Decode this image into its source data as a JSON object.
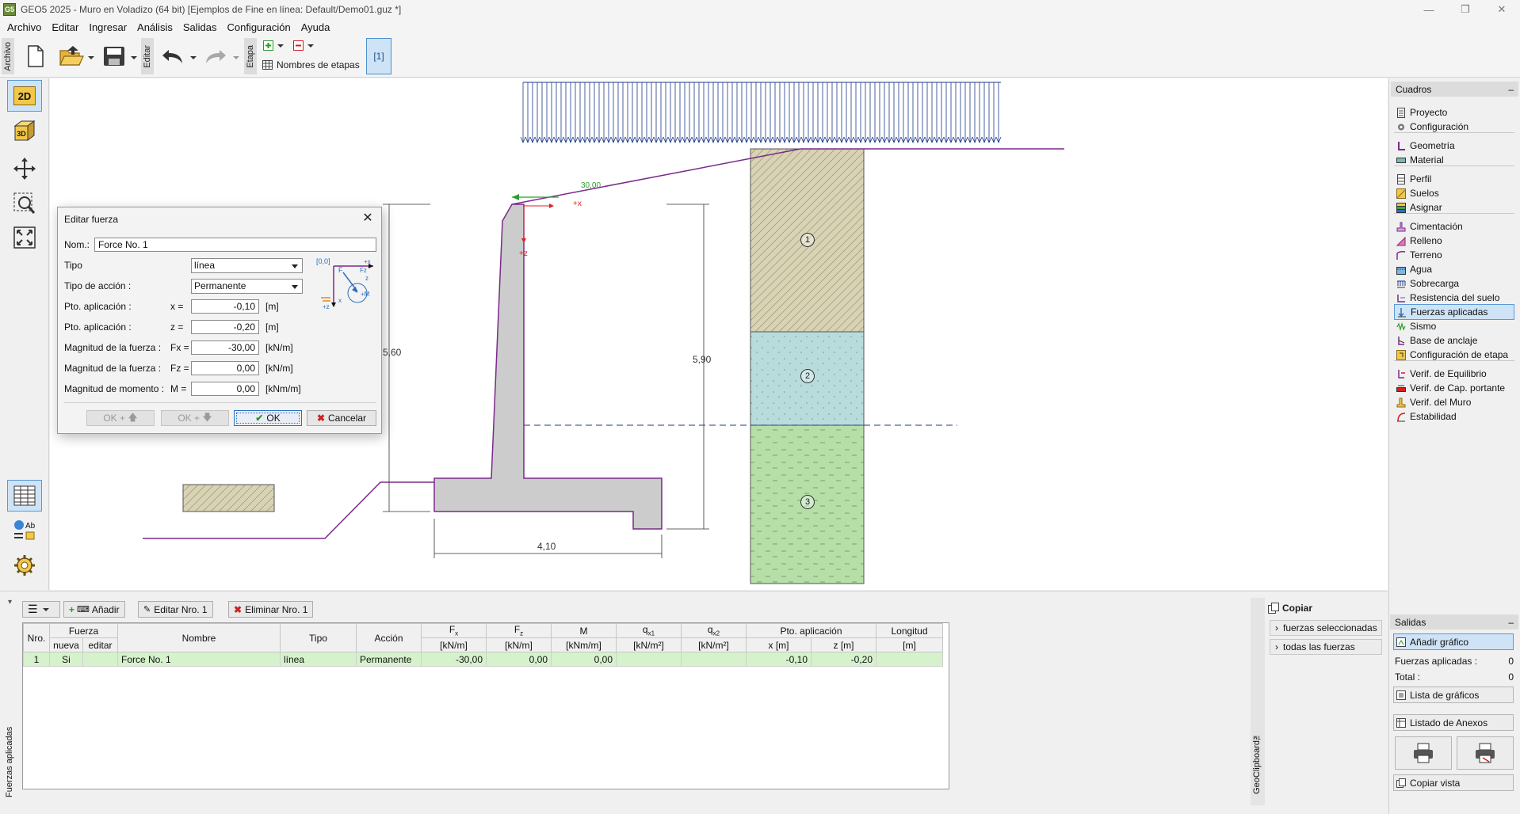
{
  "window": {
    "title": "GEO5 2025 - Muro en Voladizo (64 bit) [Ejemplos de Fine en línea: Default/Demo01.guz *]",
    "app_icon_text": "G5"
  },
  "menu": [
    "Archivo",
    "Editar",
    "Ingresar",
    "Análisis",
    "Salidas",
    "Configuración",
    "Ayuda"
  ],
  "toolbar": {
    "archivo_tab": "Archivo",
    "editar_tab": "Editar",
    "etapa_tab": "Etapa",
    "stage_names_label": "Nombres de etapas",
    "stage_button": "[1]"
  },
  "leftrail": {
    "btn_2d": "2D",
    "btn_3d": "3D"
  },
  "canvas": {
    "dim_height_wall": "5,60",
    "dim_height_soil": "5,90",
    "dim_base_width": "4,10",
    "force_value": "30,00",
    "axis_x": "+x",
    "axis_z": "+z",
    "soil_layers": [
      "1",
      "2",
      "3"
    ],
    "colors": {
      "wall": "#cccccc",
      "outline": "#7a2a8a",
      "soil1": "#d8d3b4",
      "soil2": "#b8dcdc",
      "soil3": "#b6dfa8",
      "surcharge": "#1f3b88",
      "force": "#2aa02a"
    }
  },
  "dialog": {
    "title": "Editar fuerza",
    "name_label": "Nom.:",
    "name_value": "Force No. 1",
    "type_label": "Tipo",
    "type_value": "línea",
    "action_label": "Tipo de acción :",
    "action_value": "Permanente",
    "rows": [
      {
        "label": "Pto. aplicación :",
        "eq": "x  =",
        "value": "-0,10",
        "unit": "[m]"
      },
      {
        "label": "Pto. aplicación :",
        "eq": "z  =",
        "value": "-0,20",
        "unit": "[m]"
      },
      {
        "label": "Magnitud de la fuerza :",
        "eq": "Fx =",
        "value": "-30,00",
        "unit": "[kN/m]"
      },
      {
        "label": "Magnitud de la fuerza :",
        "eq": "Fz =",
        "value": "0,00",
        "unit": "[kN/m]"
      },
      {
        "label": "Magnitud de momento :",
        "eq": "M =",
        "value": "0,00",
        "unit": "[kNm/m]"
      }
    ],
    "diagram": {
      "origin": "[0,0]",
      "fx": "+x",
      "f": "F",
      "fz": "Fz",
      "z": "z",
      "m": "+M",
      "x_axis": "x",
      "z_axis": "+z"
    },
    "btn_ok_up": "OK +",
    "btn_ok_down": "OK +",
    "btn_ok": "OK",
    "btn_cancel": "Cancelar"
  },
  "right_panel": {
    "header": "Cuadros",
    "collapse": "–",
    "items": [
      {
        "label": "Proyecto",
        "icon": "document-icon"
      },
      {
        "label": "Configuración",
        "icon": "gear-icon"
      },
      {
        "label": "Geometría",
        "icon": "geometry-icon"
      },
      {
        "label": "Material",
        "icon": "material-icon"
      },
      {
        "label": "Perfil",
        "icon": "profile-icon"
      },
      {
        "label": "Suelos",
        "icon": "soils-icon"
      },
      {
        "label": "Asignar",
        "icon": "assign-icon"
      },
      {
        "label": "Cimentación",
        "icon": "foundation-icon"
      },
      {
        "label": "Relleno",
        "icon": "backfill-icon"
      },
      {
        "label": "Terreno",
        "icon": "terrain-icon"
      },
      {
        "label": "Agua",
        "icon": "water-icon"
      },
      {
        "label": "Sobrecarga",
        "icon": "surcharge-icon"
      },
      {
        "label": "Resistencia del suelo",
        "icon": "resistance-icon"
      },
      {
        "label": "Fuerzas aplicadas",
        "icon": "forces-icon",
        "active": true
      },
      {
        "label": "Sismo",
        "icon": "earthquake-icon"
      },
      {
        "label": "Base de anclaje",
        "icon": "anchor-icon"
      },
      {
        "label": "Configuración de etapa",
        "icon": "stage-config-icon"
      },
      {
        "label": "Verif. de Equilibrio",
        "icon": "equilibrium-icon"
      },
      {
        "label": "Verif. de Cap. portante",
        "icon": "bearing-icon"
      },
      {
        "label": "Verif. del Muro",
        "icon": "wall-check-icon"
      },
      {
        "label": "Estabilidad",
        "icon": "stability-icon"
      }
    ]
  },
  "bottom": {
    "side_label": "Fuerzas aplicadas",
    "btn_add": "Añadir",
    "btn_edit": "Editar Nro. 1",
    "btn_delete": "Eliminar Nro. 1",
    "table": {
      "headers_top": [
        "Nro.",
        "Fuerza",
        "Nombre",
        "Tipo",
        "Acción",
        "F",
        "F",
        "M",
        "q",
        "q",
        "Pto. aplicación",
        "Longitud"
      ],
      "header_subs": {
        "fx": "x",
        "fz": "z",
        "qx1": "x1",
        "qx2": "x2"
      },
      "headers_bottom": [
        "nueva",
        "editar",
        "[kN/m]",
        "[kN/m]",
        "[kNm/m]",
        "[kN/m²]",
        "[kN/m²]",
        "x [m]",
        "z [m]",
        "[m]"
      ],
      "rows": [
        {
          "nro": "1",
          "nueva": "Si",
          "editar": "",
          "nombre": "Force No. 1",
          "tipo": "línea",
          "accion": "Permanente",
          "fx": "-30,00",
          "fz": "0,00",
          "m": "0,00",
          "qx1": "",
          "qx2": "",
          "x": "-0,10",
          "z": "-0,20",
          "longitud": ""
        }
      ]
    },
    "geoclipboard_label": "GeoClipboard™",
    "copy_title": "Copiar",
    "copy_selected": "fuerzas seleccionadas",
    "copy_all": "todas las fuerzas"
  },
  "outputs": {
    "header": "Salidas",
    "collapse": "–",
    "add_graphic": "Añadir gráfico",
    "forces_label": "Fuerzas aplicadas :",
    "forces_count": "0",
    "total_label": "Total :",
    "total_count": "0",
    "graphics_list": "Lista de gráficos",
    "annex_list": "Listado de Anexos",
    "copy_view": "Copiar vista"
  }
}
